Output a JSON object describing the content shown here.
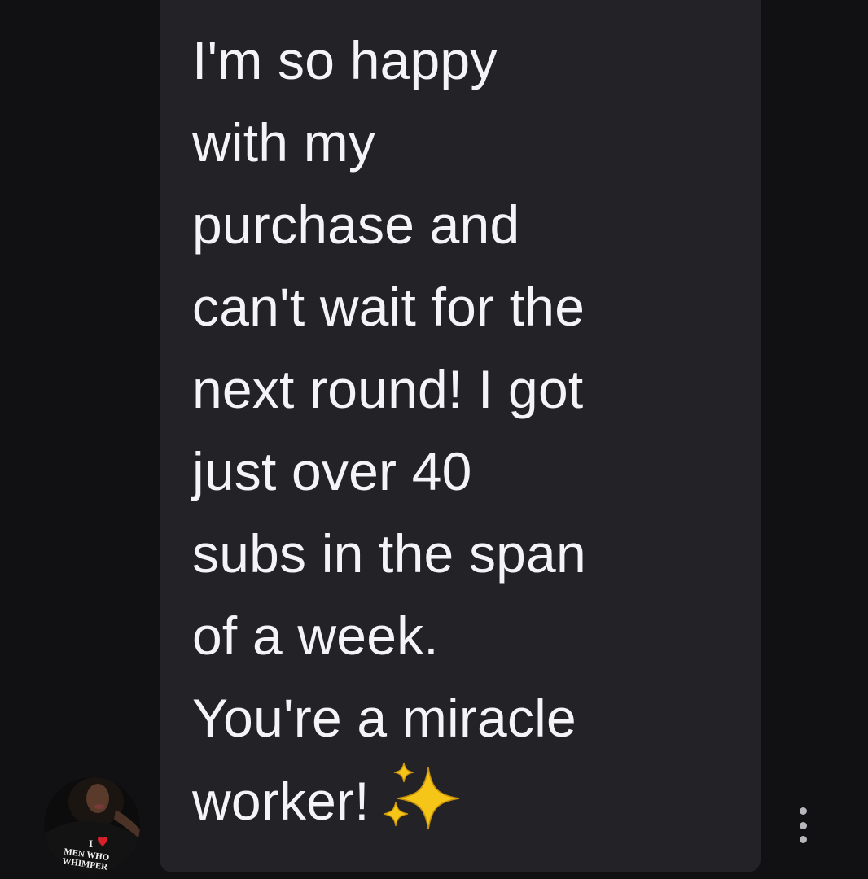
{
  "message": {
    "lines": [
      "I'm so happy",
      "with my",
      "purchase and",
      "can't wait for the",
      "next round! I got",
      "just over 40",
      "subs in the span",
      "of a week.",
      "You're a miracle",
      "worker!"
    ],
    "emoji": "sparkles-icon"
  },
  "avatar": {
    "shirt_text_line1": "I",
    "shirt_text_line2": "MEN WHO",
    "shirt_text_line3": "WHIMPER"
  },
  "colors": {
    "background": "#111113",
    "bubble": "#232327",
    "text": "#f4f4f6",
    "sparkle": "#f5c518",
    "heart": "#d81f2a"
  },
  "icons": {
    "more": "more-vertical-icon",
    "avatar": "avatar"
  }
}
